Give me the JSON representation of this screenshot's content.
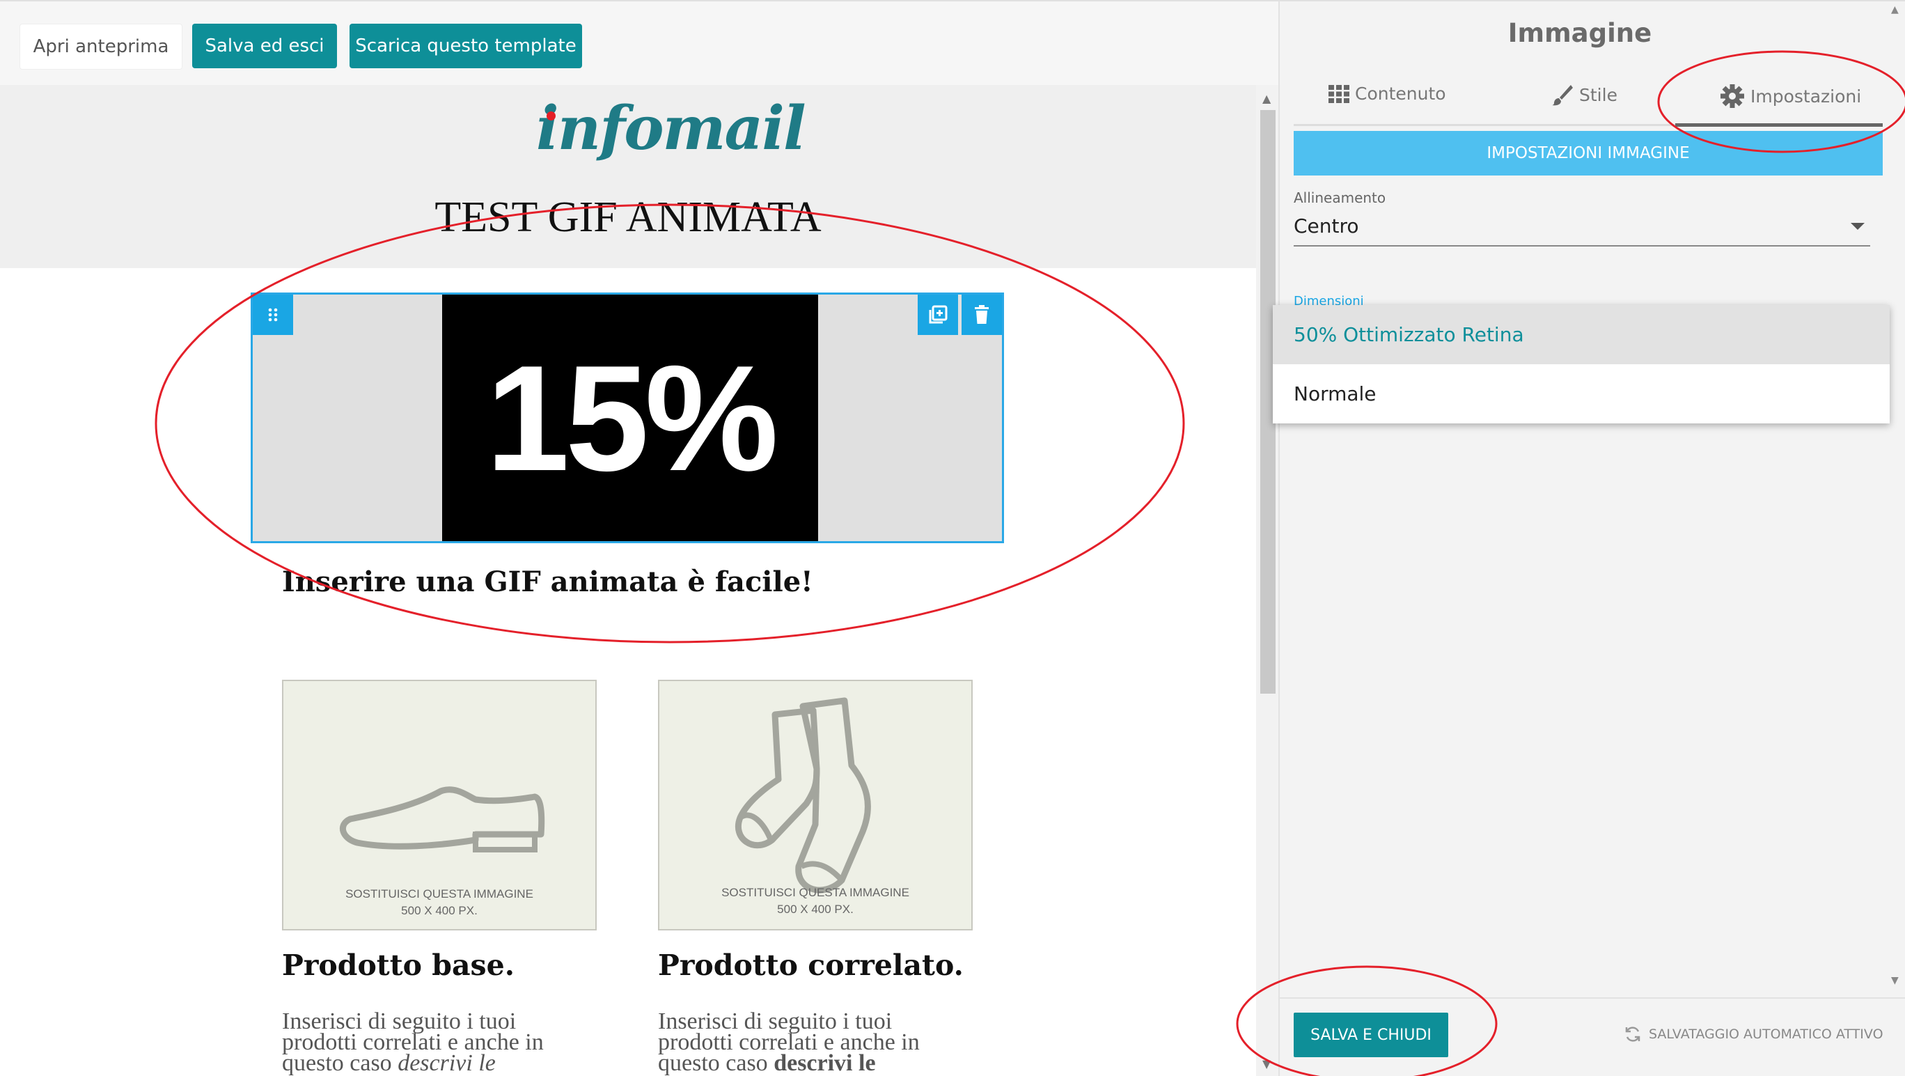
{
  "toolbar": {
    "preview_label": "Apri anteprima",
    "save_exit_label": "Salva ed esci",
    "download_label": "Scarica questo template"
  },
  "email": {
    "logo_text": "infomail",
    "title": "TEST GIF ANIMATA",
    "gif_text": "15%",
    "caption": "Inserire una GIF animata è facile!",
    "products": [
      {
        "image_caption_1": "SOSTITUISCI QUESTA IMMAGINE",
        "image_caption_2": "500 X 400 PX.",
        "title": "Prodotto base.",
        "desc_1": "Inserisci di seguito i tuoi",
        "desc_2": "prodotti correlati e anche in",
        "desc_3a": "questo caso ",
        "desc_3b": "descrivi le"
      },
      {
        "image_caption_1": "SOSTITUISCI QUESTA IMMAGINE",
        "image_caption_2": "500 X 400 PX.",
        "title": "Prodotto correlato.",
        "desc_1": "Inserisci di seguito i tuoi",
        "desc_2": "prodotti correlati e anche in",
        "desc_3a": "questo caso ",
        "desc_3b": "descrivi le"
      }
    ]
  },
  "panel": {
    "title": "Immagine",
    "tabs": [
      {
        "label": "Contenuto",
        "icon": "grid-icon"
      },
      {
        "label": "Stile",
        "icon": "brush-icon"
      },
      {
        "label": "Impostazioni",
        "icon": "gear-icon",
        "active": true
      }
    ],
    "section_title": "IMPOSTAZIONI IMMAGINE",
    "alignment_label": "Allineamento",
    "alignment_value": "Centro",
    "dimensions_label": "Dimensioni",
    "dimensions_options": [
      "50% Ottimizzato Retina",
      "Normale"
    ],
    "dimensions_selected": "50% Ottimizzato Retina",
    "save_close_label": "SALVA E CHIUDI",
    "autosave_label": "SALVATAGGIO AUTOMATICO ATTIVO"
  },
  "colors": {
    "teal": "#0e8f98",
    "accent_blue": "#4fc0f0",
    "selection_blue": "#1aa6e4",
    "annotation_red": "#e4202a"
  }
}
